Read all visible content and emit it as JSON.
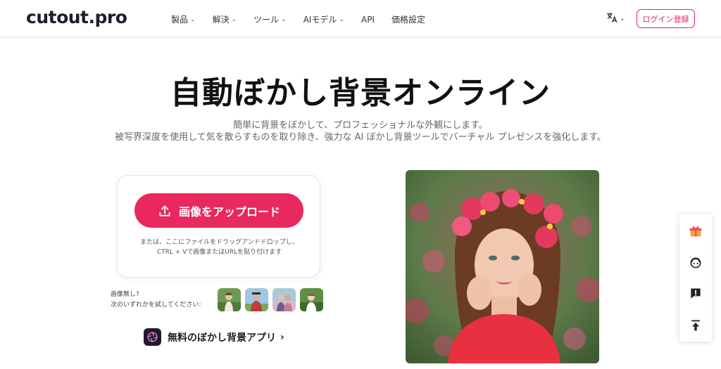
{
  "header": {
    "logo": "cutout.pro",
    "nav": [
      {
        "label": "製品",
        "has_menu": true
      },
      {
        "label": "解決",
        "has_menu": true
      },
      {
        "label": "ツール",
        "has_menu": true
      },
      {
        "label": "AIモデル",
        "has_menu": true
      },
      {
        "label": "API",
        "has_menu": false
      },
      {
        "label": "価格設定",
        "has_menu": false
      }
    ],
    "language_icon": "translate-icon",
    "login_label": "ログイン登録"
  },
  "hero": {
    "title": "自動ぼかし背景オンライン",
    "subtitle_line1": "簡単に背景をぼかして、プロフェッショナルな外観にします。",
    "subtitle_line2": "被写界深度を使用して気を散らすものを取り除き、強力な AI ぼかし背景ツールでバーチャル プレゼンスを強化します。"
  },
  "upload": {
    "button_label": "画像をアップロード",
    "hint_line1": "または、ここにファイルをドラッグアンドドロップし、",
    "hint_line2": "CTRL + Vで画像またはURLを貼り付けます"
  },
  "samples": {
    "no_image_line1": "画像無し?",
    "no_image_line2": "次のいずれかを試してください:"
  },
  "app_link": {
    "label": "無料のぼかし背景アプリ",
    "icon": "aperture-icon"
  },
  "colors": {
    "accent": "#e8285f",
    "login_border": "#e0245e",
    "text_dark": "#111111",
    "text_muted": "#666666"
  },
  "side_toolbar": {
    "icons": [
      "gift-icon",
      "support-agent-icon",
      "feedback-icon",
      "back-to-top-icon"
    ]
  }
}
